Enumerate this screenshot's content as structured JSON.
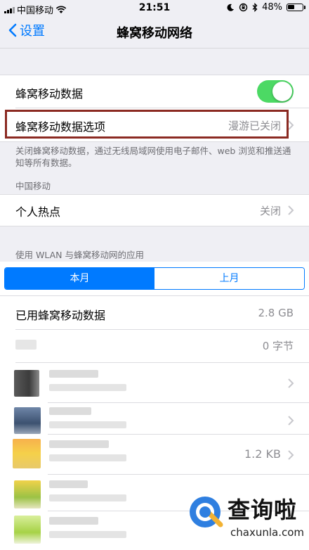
{
  "status_bar": {
    "carrier": "中国移动",
    "time": "21:51",
    "battery": "48%",
    "battery_level": 0.48
  },
  "nav": {
    "back_label": "设置",
    "title": "蜂窝移动网络"
  },
  "cellular_data": {
    "label": "蜂窝移动数据",
    "enabled": true
  },
  "data_options": {
    "label": "蜂窝移动数据选项",
    "value": "漫游已关闭"
  },
  "footer_note": "关闭蜂窝移动数据，通过无线局域网使用电子邮件、web 浏览和推送通知等所有数据。",
  "carrier_section": {
    "header": "中国移动",
    "hotspot_label": "个人热点",
    "hotspot_value": "关闭"
  },
  "usage": {
    "section_header": "使用 WLAN 与蜂窝移动网的应用",
    "segments": [
      "本月",
      "上月"
    ],
    "used_label": "已用蜂窝移动数据",
    "used_value": "2.8 GB",
    "apps": [
      {
        "value": "0 字节"
      },
      {
        "value": ""
      },
      {
        "value": ""
      },
      {
        "value": "1.2 KB"
      },
      {
        "value": ""
      },
      {
        "value": ""
      }
    ]
  },
  "watermark": {
    "name": "查询啦",
    "domain": "chaxunla.com"
  },
  "colors": {
    "accent": "#007aff",
    "toggle_on": "#4cd964",
    "highlight_border": "#8b2a22",
    "background": "#efeff4"
  }
}
